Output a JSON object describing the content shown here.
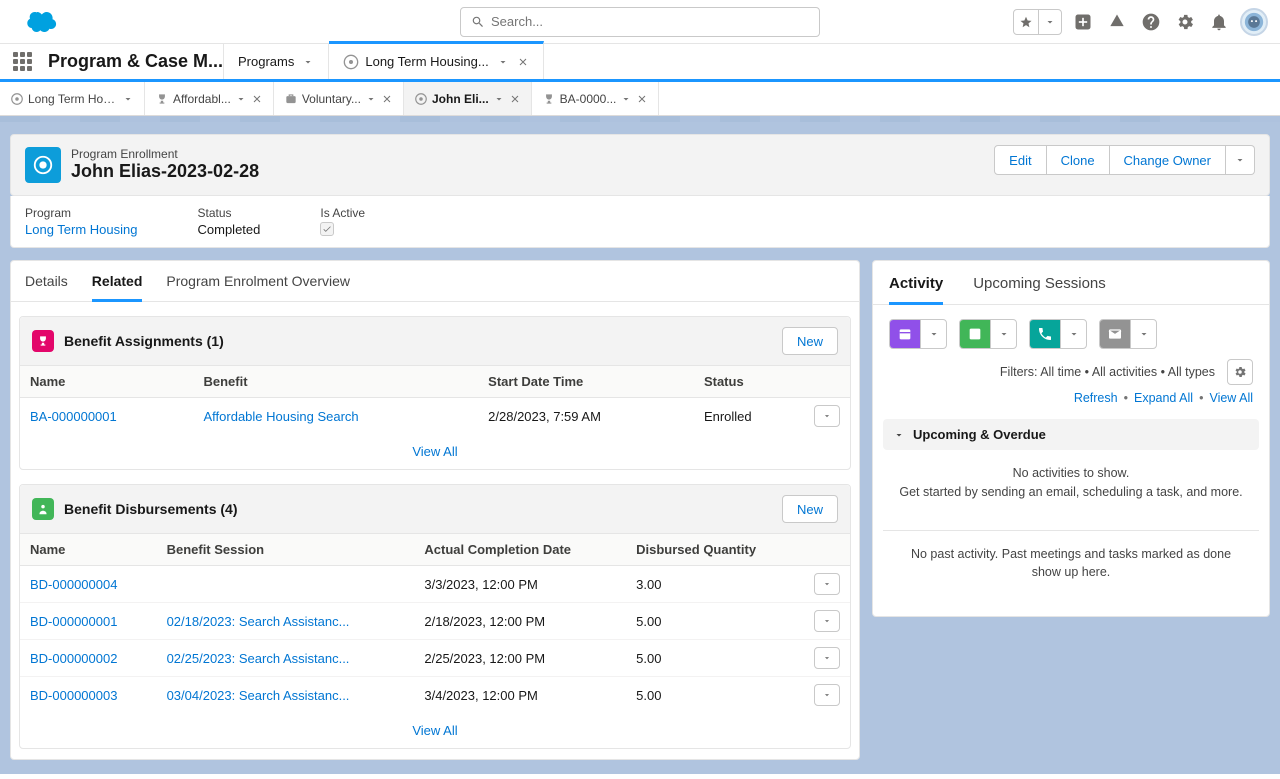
{
  "header": {
    "search_placeholder": "Search...",
    "app_name": "Program & Case M..."
  },
  "nav_tabs": [
    {
      "label": "Programs",
      "closable": false,
      "active": false,
      "has_icon": false
    },
    {
      "label": "Long Term Housing...",
      "closable": true,
      "active": true,
      "has_icon": true
    }
  ],
  "sub_tabs": [
    {
      "label": "Long Term Hous...",
      "icon": "program",
      "closable": false,
      "active": false
    },
    {
      "label": "Affordabl...",
      "icon": "trophy",
      "closable": true,
      "active": false
    },
    {
      "label": "Voluntary...",
      "icon": "case",
      "closable": true,
      "active": false
    },
    {
      "label": "John Eli...",
      "icon": "enroll",
      "closable": true,
      "active": true
    },
    {
      "label": "BA-0000...",
      "icon": "trophy",
      "closable": true,
      "active": false
    }
  ],
  "record": {
    "type_label": "Program Enrollment",
    "title": "John Elias-2023-02-28",
    "actions": {
      "edit": "Edit",
      "clone": "Clone",
      "change_owner": "Change Owner"
    },
    "fields": {
      "program_label": "Program",
      "program_value": "Long Term Housing",
      "status_label": "Status",
      "status_value": "Completed",
      "active_label": "Is Active"
    }
  },
  "inner_tabs": {
    "details": "Details",
    "related": "Related",
    "overview": "Program Enrolment Overview"
  },
  "benefit_assignments": {
    "title": "Benefit Assignments (1)",
    "new_label": "New",
    "cols": [
      "Name",
      "Benefit",
      "Start Date Time",
      "Status"
    ],
    "rows": [
      {
        "name": "BA-000000001",
        "benefit": "Affordable Housing Search",
        "start": "2/28/2023, 7:59 AM",
        "status": "Enrolled"
      }
    ],
    "view_all": "View All"
  },
  "benefit_disbursements": {
    "title": "Benefit Disbursements (4)",
    "new_label": "New",
    "cols": [
      "Name",
      "Benefit Session",
      "Actual Completion Date",
      "Disbursed Quantity"
    ],
    "rows": [
      {
        "name": "BD-000000004",
        "session": "",
        "date": "3/3/2023, 12:00 PM",
        "qty": "3.00"
      },
      {
        "name": "BD-000000001",
        "session": "02/18/2023: Search Assistanc...",
        "date": "2/18/2023, 12:00 PM",
        "qty": "5.00"
      },
      {
        "name": "BD-000000002",
        "session": "02/25/2023: Search Assistanc...",
        "date": "2/25/2023, 12:00 PM",
        "qty": "5.00"
      },
      {
        "name": "BD-000000003",
        "session": "03/04/2023: Search Assistanc...",
        "date": "3/4/2023, 12:00 PM",
        "qty": "5.00"
      }
    ],
    "view_all": "View All"
  },
  "side": {
    "tabs": {
      "activity": "Activity",
      "upcoming": "Upcoming Sessions"
    },
    "filters_text": "Filters: All time • All activities • All types",
    "links": {
      "refresh": "Refresh",
      "expand": "Expand All",
      "viewall": "View All"
    },
    "section": "Upcoming & Overdue",
    "empty1": "No activities to show.",
    "empty2": "Get started by sending an email, scheduling a task, and more.",
    "nopast": "No past activity. Past meetings and tasks marked as done show up here."
  }
}
